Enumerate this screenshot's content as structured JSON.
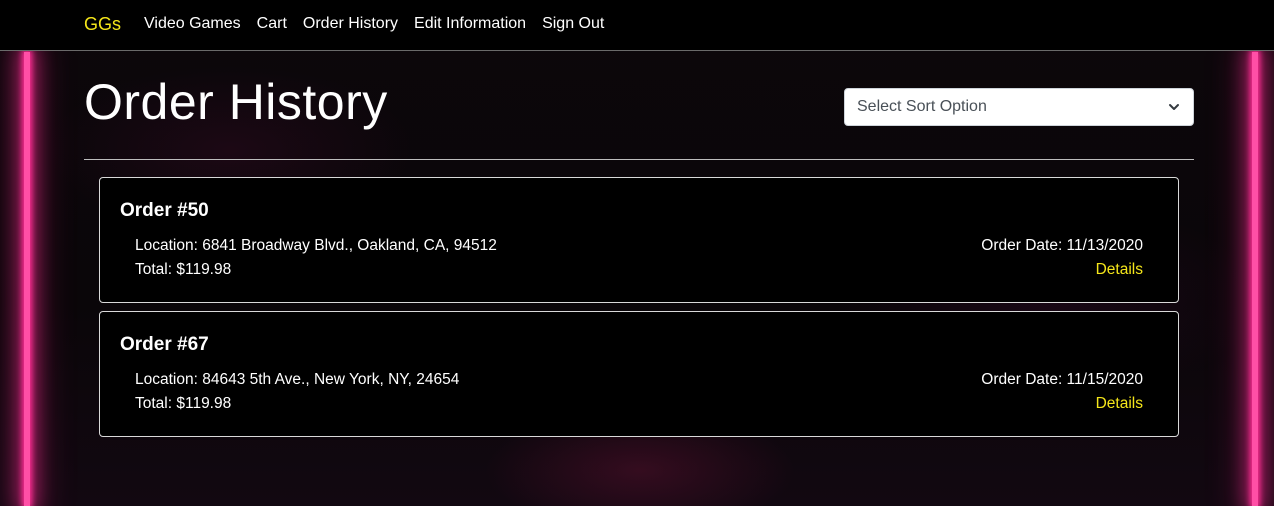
{
  "navbar": {
    "brand": "GGs",
    "links": [
      {
        "label": "Video Games"
      },
      {
        "label": "Cart"
      },
      {
        "label": "Order History"
      },
      {
        "label": "Edit Information"
      },
      {
        "label": "Sign Out"
      }
    ]
  },
  "page": {
    "title": "Order History"
  },
  "sort": {
    "selected": "Select Sort Option"
  },
  "orders": [
    {
      "title": "Order #50",
      "location": "Location: 6841 Broadway Blvd., Oakland, CA, 94512",
      "total": "Total: $119.98",
      "date": "Order Date: 11/13/2020",
      "details_label": "Details"
    },
    {
      "title": "Order #67",
      "location": "Location: 84643 5th Ave., New York, NY, 24654",
      "total": "Total: $119.98",
      "date": "Order Date: 11/15/2020",
      "details_label": "Details"
    }
  ],
  "colors": {
    "accent": "#f5e61a",
    "neon": "#ff2d95",
    "background": "#0a0609"
  },
  "icons": {
    "sort_dropdown": "chevron-down-icon"
  }
}
